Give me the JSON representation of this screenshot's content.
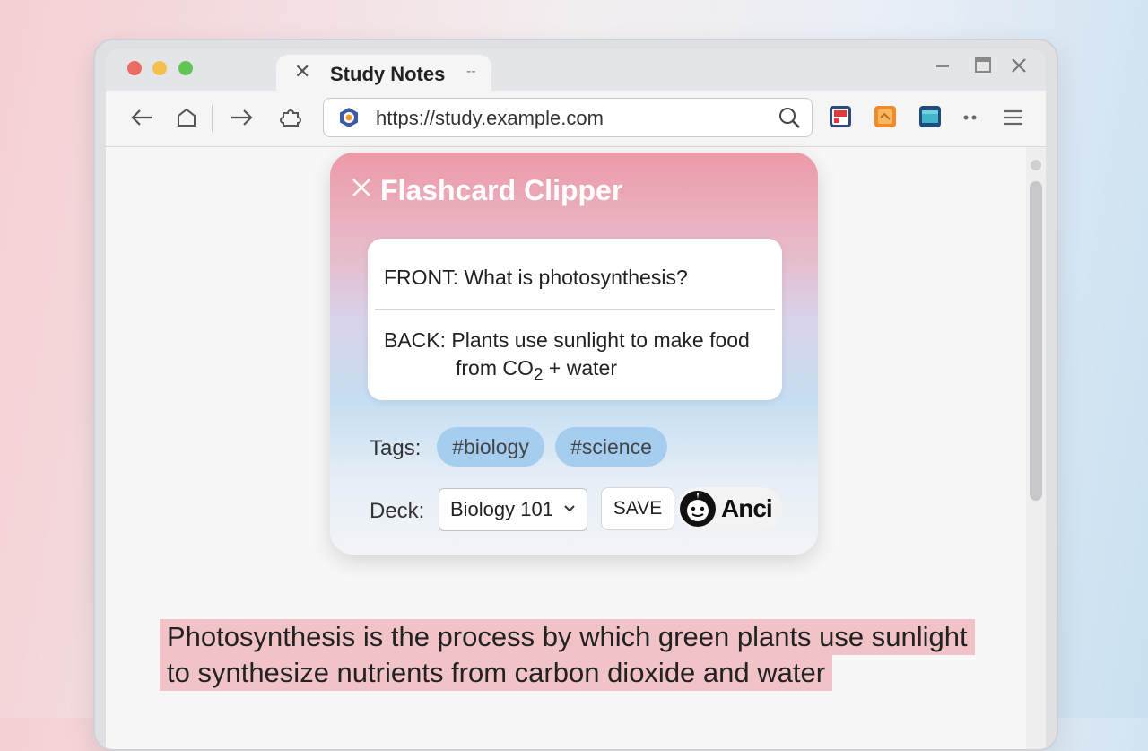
{
  "tab": {
    "title": "Study Notes",
    "extra": "--"
  },
  "address_bar": {
    "url": "https://study.example.com"
  },
  "popup": {
    "title": "Flashcard Clipper",
    "card": {
      "front_label": "FRONT:",
      "front_text": "What is photosynthesis?",
      "back_label": "BACK:",
      "back_text_line1": "Plants use sunlight to make food",
      "back_text_line2_pre": "from CO",
      "back_text_subscript": "2",
      "back_text_line2_post": " + water"
    },
    "tags_label": "Tags:",
    "tags": [
      "#biology",
      "#science"
    ],
    "deck_label": "Deck:",
    "deck_selected": "Biology 101",
    "save_label": "SAVE",
    "brand_name": "Anci"
  },
  "page": {
    "highlight_line1": "Photosynthesis is the process by which green plants use sunlight",
    "highlight_line2": "to synthesize nutrients from carbon dioxide and water"
  },
  "colors": {
    "popup_top": "#ec9aa7",
    "popup_mid": "#c5def2",
    "tag_bg": "#a4cdf0",
    "highlight_bg": "#f2c3c6"
  }
}
